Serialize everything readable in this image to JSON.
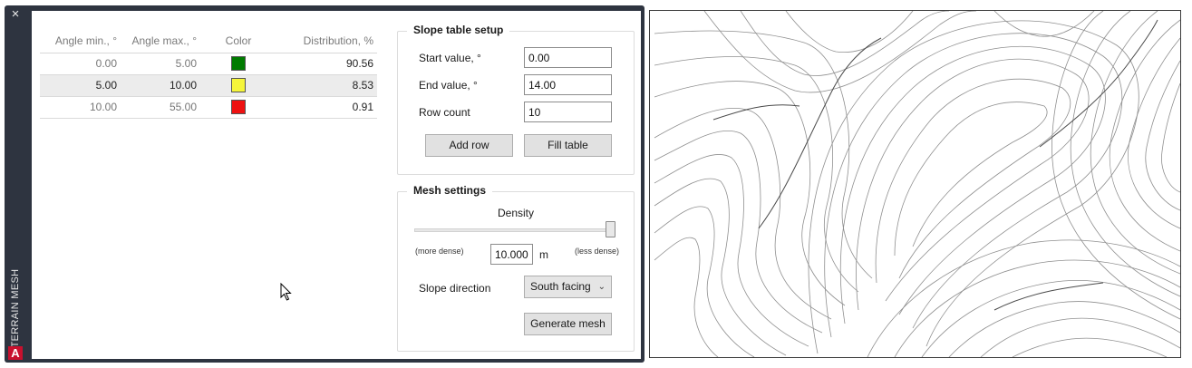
{
  "palette": {
    "title": "TERRAIN MESH",
    "close_icon": "×",
    "logo_letter": "A"
  },
  "table": {
    "columns": [
      "Angle min., °",
      "Angle max., °",
      "Color",
      "Distribution, %"
    ],
    "rows": [
      {
        "min": "0.00",
        "max": "5.00",
        "color": "#007b00",
        "dist": "90.56"
      },
      {
        "min": "5.00",
        "max": "10.00",
        "color": "#f5f53a",
        "dist": "8.53",
        "selected": true
      },
      {
        "min": "10.00",
        "max": "55.00",
        "color": "#ee1111",
        "dist": "0.91"
      }
    ]
  },
  "setup": {
    "title": "Slope table setup",
    "start_label": "Start value, °",
    "start_value": "0.00",
    "end_label": "End value, °",
    "end_value": "14.00",
    "rows_label": "Row count",
    "rows_value": "10",
    "add_row": "Add row",
    "fill_table": "Fill table"
  },
  "mesh": {
    "title": "Mesh settings",
    "density_label": "Density",
    "density_level": 1.0,
    "more_dense": "(more dense)",
    "less_dense": "(less dense)",
    "density_value": "10.000",
    "unit": "m",
    "direction_label": "Slope direction",
    "direction_value": "South facing",
    "generate": "Generate mesh"
  },
  "colors": {
    "palette_frame": "#2e3440",
    "button_bg": "#e1e1e1",
    "selected_row": "#ececec"
  }
}
